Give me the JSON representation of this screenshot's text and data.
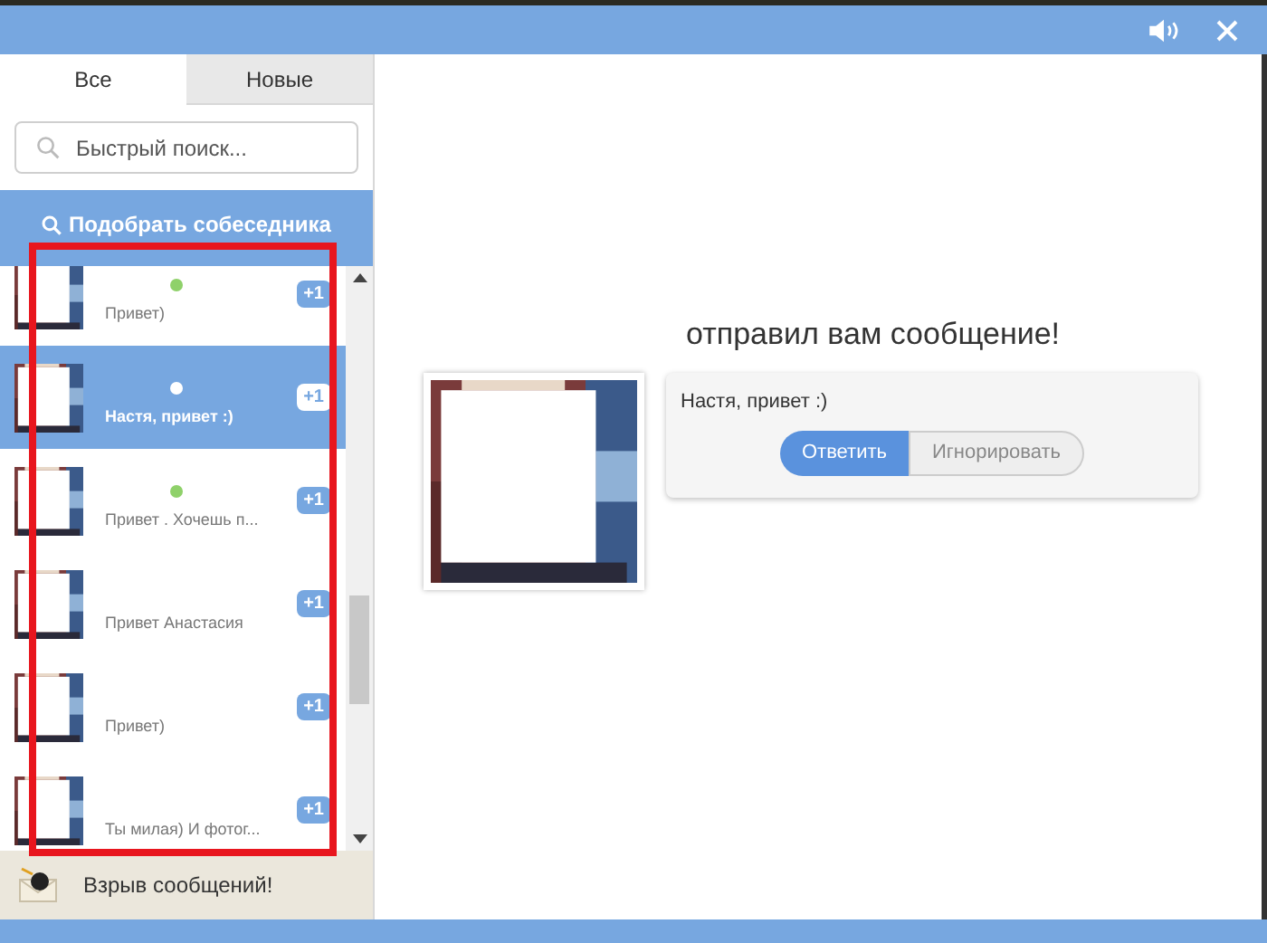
{
  "tabs": [
    {
      "label": "Все",
      "selected": true
    },
    {
      "label": "Новые",
      "selected": false
    }
  ],
  "search": {
    "placeholder": "Быстрый поиск..."
  },
  "find_button": "Подобрать собеседника",
  "conversations": [
    {
      "message": "Привет)",
      "online": true,
      "selected": false,
      "unread": "+1"
    },
    {
      "message": "Настя, привет :)",
      "online": true,
      "selected": true,
      "unread": "+1"
    },
    {
      "message": "Привет . Хочешь п...",
      "online": true,
      "selected": false,
      "unread": "+1"
    },
    {
      "message": "Привет Анастасия",
      "online": false,
      "selected": false,
      "unread": "+1"
    },
    {
      "message": "Привет)",
      "online": false,
      "selected": false,
      "unread": "+1"
    },
    {
      "message": "Ты милая) И фотог...",
      "online": false,
      "selected": false,
      "unread": "+1"
    }
  ],
  "footer": "Взрыв сообщений!",
  "notification": {
    "heading": "отправил вам сообщение!",
    "message": "Настя, привет :)",
    "buttons": [
      {
        "label": "Ответить",
        "kind": "primary"
      },
      {
        "label": "Игнорировать",
        "kind": "secondary"
      }
    ]
  }
}
